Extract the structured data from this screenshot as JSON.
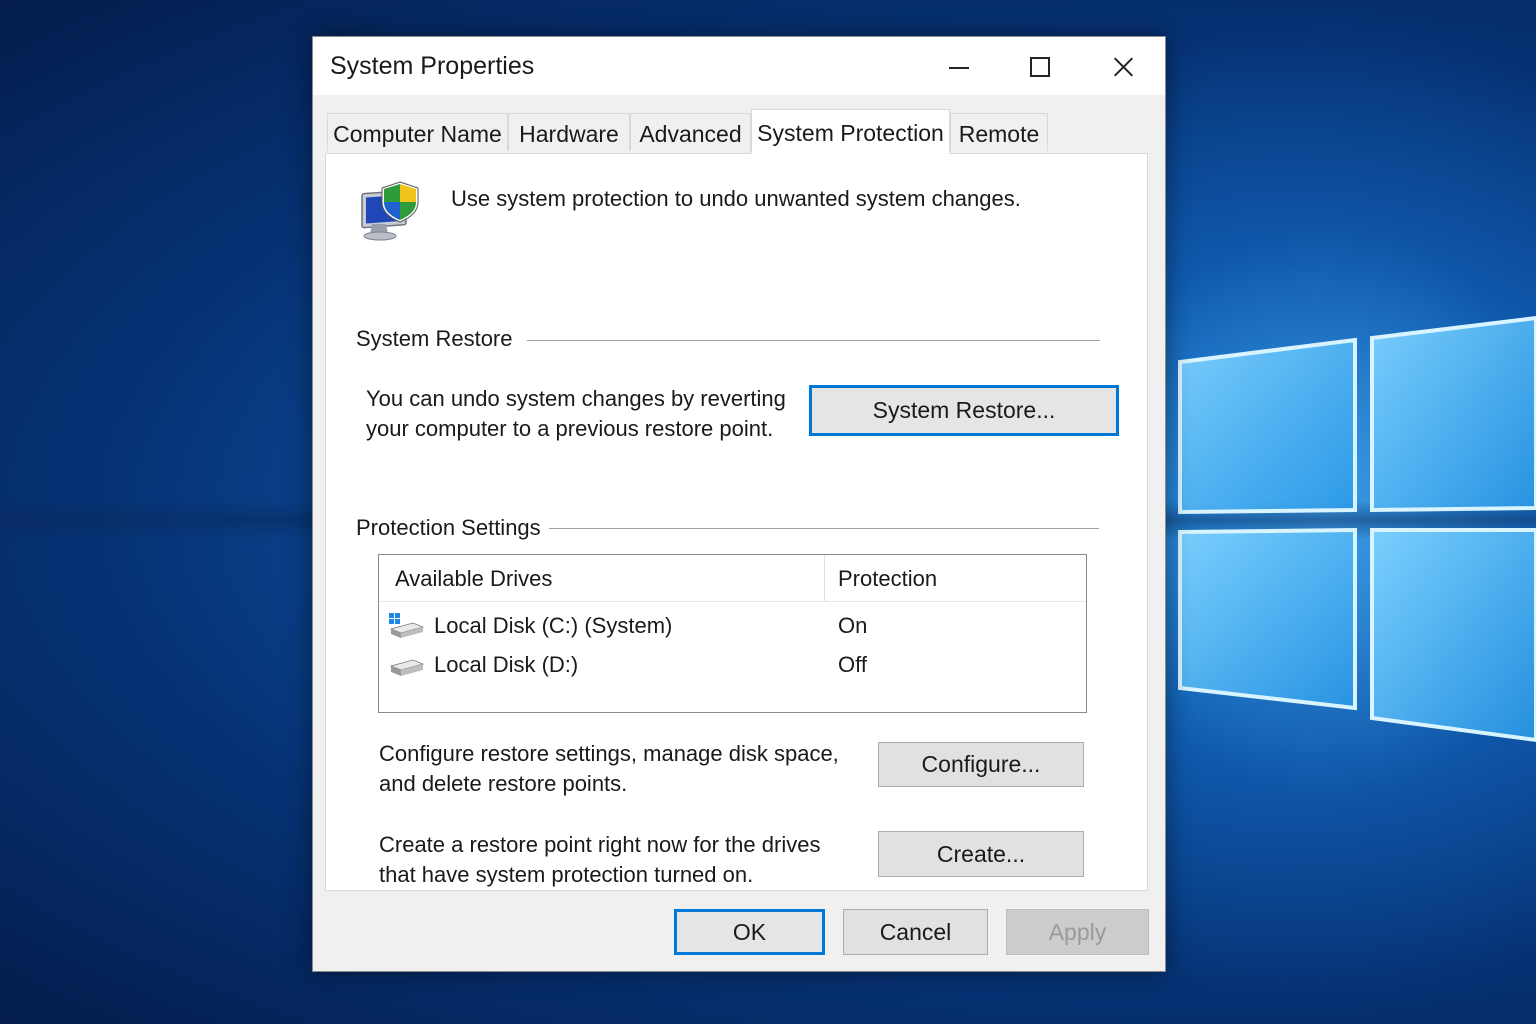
{
  "window": {
    "title": "System Properties",
    "controls": {
      "minimize": "minimize-icon",
      "maximize": "maximize-icon",
      "close": "close-icon"
    }
  },
  "tabs": [
    {
      "label": "Computer Name",
      "active": false
    },
    {
      "label": "Hardware",
      "active": false
    },
    {
      "label": "Advanced",
      "active": false
    },
    {
      "label": "System Protection",
      "active": true
    },
    {
      "label": "Remote",
      "active": false
    }
  ],
  "intro": {
    "icon": "system-protection-icon",
    "text": "Use system protection to undo unwanted system changes."
  },
  "system_restore": {
    "group_label": "System Restore",
    "description": "You can undo system changes by reverting your computer to a previous restore point.",
    "button_label": "System Restore..."
  },
  "protection_settings": {
    "group_label": "Protection Settings",
    "columns": [
      "Available Drives",
      "Protection"
    ],
    "drives": [
      {
        "name": "Local Disk (C:) (System)",
        "protection": "On",
        "icon": "system-drive-icon"
      },
      {
        "name": "Local Disk (D:)",
        "protection": "Off",
        "icon": "drive-icon"
      }
    ],
    "configure_text": "Configure restore settings, manage disk space, and delete restore points.",
    "configure_button": "Configure...",
    "create_text": "Create a restore point right now for the drives that have system protection turned on.",
    "create_button": "Create..."
  },
  "footer": {
    "ok": "OK",
    "cancel": "Cancel",
    "apply": "Apply"
  },
  "colors": {
    "accent": "#0078d7",
    "window_bg": "#f0f0f0",
    "panel_bg": "#ffffff",
    "desktop": "#0b4f9e"
  }
}
